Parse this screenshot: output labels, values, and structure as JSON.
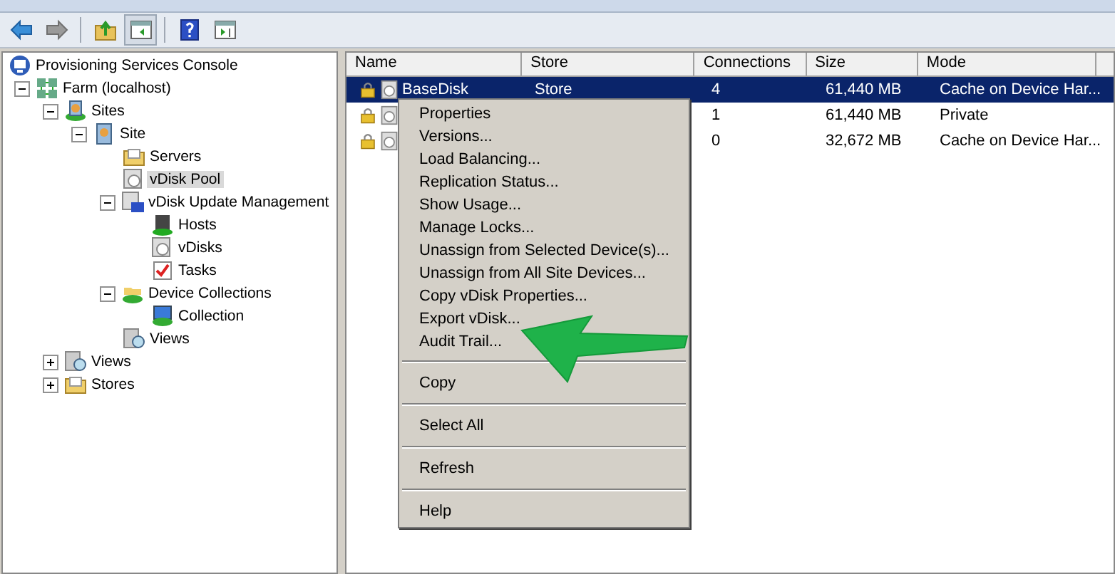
{
  "toolbar": {
    "buttons": [
      {
        "kind": "back",
        "pressed": false
      },
      {
        "kind": "forward",
        "pressed": false
      },
      {
        "kind": "up",
        "pressed": false
      },
      {
        "kind": "tree",
        "pressed": true
      },
      {
        "kind": "help",
        "pressed": false
      },
      {
        "kind": "pane",
        "pressed": false
      }
    ]
  },
  "tree": {
    "root": {
      "label": "Provisioning Services Console",
      "kind": "console",
      "selected": false,
      "children": [
        {
          "label": "Farm (localhost)",
          "kind": "farm",
          "selected": false,
          "expanded": true,
          "children": [
            {
              "label": "Sites",
              "kind": "sites",
              "selected": false,
              "expanded": true,
              "children": [
                {
                  "label": "Site",
                  "kind": "site",
                  "selected": false,
                  "expanded": true,
                  "children": [
                    {
                      "label": "Servers",
                      "kind": "folder",
                      "selected": false
                    },
                    {
                      "label": "vDisk Pool",
                      "kind": "disk",
                      "selected": true
                    },
                    {
                      "label": "vDisk Update Management",
                      "kind": "update",
                      "selected": false,
                      "expanded": true,
                      "children": [
                        {
                          "label": "Hosts",
                          "kind": "hosts",
                          "selected": false
                        },
                        {
                          "label": "vDisks",
                          "kind": "disk",
                          "selected": false
                        },
                        {
                          "label": "Tasks",
                          "kind": "tasks",
                          "selected": false
                        }
                      ]
                    },
                    {
                      "label": "Device Collections",
                      "kind": "collections",
                      "selected": false,
                      "expanded": true,
                      "children": [
                        {
                          "label": "Collection",
                          "kind": "collection",
                          "selected": false
                        }
                      ]
                    },
                    {
                      "label": "Views",
                      "kind": "views",
                      "selected": false
                    }
                  ]
                }
              ]
            },
            {
              "label": "Views",
              "kind": "views",
              "selected": false,
              "expanded": false
            },
            {
              "label": "Stores",
              "kind": "folder",
              "selected": false,
              "expanded": false
            }
          ]
        }
      ]
    }
  },
  "table": {
    "columns": [
      "Name",
      "Store",
      "Connections",
      "Size",
      "Mode"
    ],
    "rows": [
      {
        "name": "BaseDisk",
        "store": "Store",
        "connections": "4",
        "size": "61,440 MB",
        "mode": "Cache on Device Har...",
        "selected": true
      },
      {
        "connections": "1",
        "size": "61,440 MB",
        "mode": "Private",
        "selected": false
      },
      {
        "connections": "0",
        "size": "32,672 MB",
        "mode": "Cache on Device Har...",
        "selected": false
      }
    ]
  },
  "context_menu": {
    "groups": [
      [
        "Properties",
        "Versions...",
        "Load Balancing...",
        "Replication Status...",
        "Show Usage...",
        "Manage Locks...",
        "Unassign from Selected Device(s)...",
        "Unassign from All Site Devices...",
        "Copy vDisk Properties...",
        "Export vDisk...",
        "Audit Trail..."
      ],
      [
        "Copy"
      ],
      [
        "Select All"
      ],
      [
        "Refresh"
      ],
      [
        "Help"
      ]
    ]
  }
}
